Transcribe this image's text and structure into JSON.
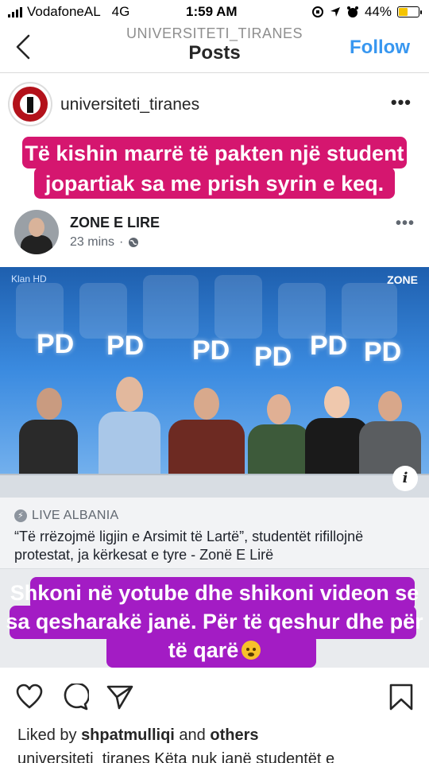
{
  "status_bar": {
    "carrier": "VodafoneAL",
    "network": "4G",
    "time": "1:59 AM",
    "battery": "44%",
    "battery_level": 0.44
  },
  "header": {
    "username": "UNIVERSITETI_TIRANES",
    "title": "Posts",
    "follow_label": "Follow"
  },
  "post": {
    "username": "universiteti_tiranes",
    "more_label": "•••",
    "top_caption": "Të kishin marrë të pakten një student jopartiak sa me prish syrin e keq.",
    "fb": {
      "name": "ZONE E LIRE",
      "time": "23 mins",
      "dot": "·",
      "more_label": "•••"
    },
    "video": {
      "left_logo": "Klan HD",
      "corner_logo": "ZONE",
      "pd_signs": [
        "PD",
        "PD",
        "PD",
        "PD",
        "PD",
        "PD"
      ],
      "info_label": "i"
    },
    "link": {
      "source": "LIVE ALBANIA",
      "title": "“Të rrëzojmë ligjin e Arsimit të Lartë”, studentët rifillojnë protestat, ja kërkesat e tyre - Zonë E Lirë"
    },
    "bottom_caption": "Shkoni në yotube dhe shikoni videon se sa qesharakë janë. Për të qeshur dhe për të qarë"
  },
  "actions": {
    "icons": [
      "heart-icon",
      "comment-icon",
      "share-icon",
      "bookmark-icon"
    ]
  },
  "likes": {
    "prefix": "Liked by",
    "user": "shpatmulliqi",
    "middle": "and",
    "others": "others"
  },
  "caption_peek": "universiteti_tiranes Këta nuk janë studentët e"
}
